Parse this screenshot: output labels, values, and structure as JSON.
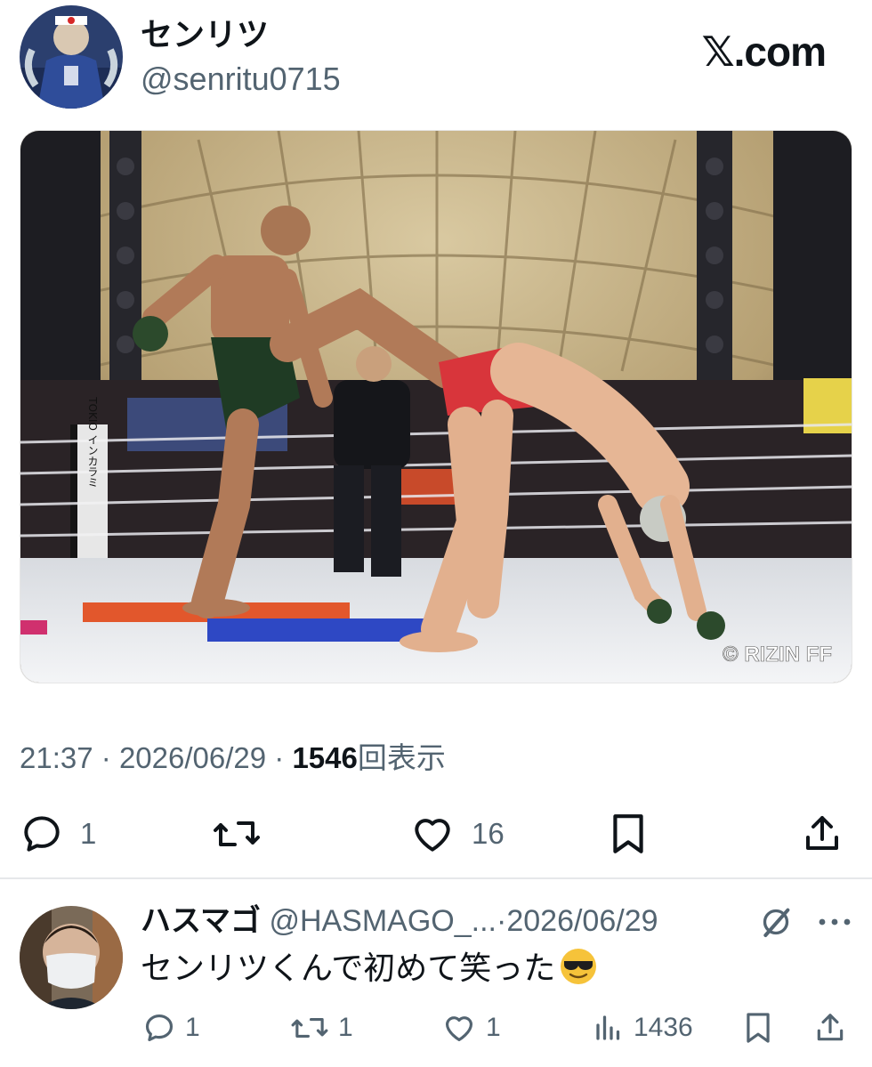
{
  "tweet": {
    "author": {
      "display_name": "センリツ",
      "handle": "@senritu0715"
    },
    "brand": "𝕏.com",
    "image": {
      "credit": "© RIZIN FF",
      "banner_text": "TOKIO インカラミ"
    },
    "meta": {
      "time": "21:37",
      "date": "2026/06/29",
      "separator": "·",
      "views_count": "1546",
      "views_label": "回表示"
    },
    "actions": {
      "reply_count": "1",
      "repost_count": "",
      "like_count": "16"
    }
  },
  "reply": {
    "display_name": "ハスマゴ",
    "handle": "@HASMAGO_...",
    "separator": "·",
    "date": "2026/06/29",
    "text": "センリツくんで初めて笑った",
    "emoji": "smiling-face-with-sunglasses",
    "actions": {
      "reply_count": "1",
      "repost_count": "1",
      "like_count": "1",
      "views_count": "1436"
    }
  },
  "colors": {
    "text": "#0f1419",
    "secondary": "#536471",
    "divider": "#e6e8ea"
  }
}
